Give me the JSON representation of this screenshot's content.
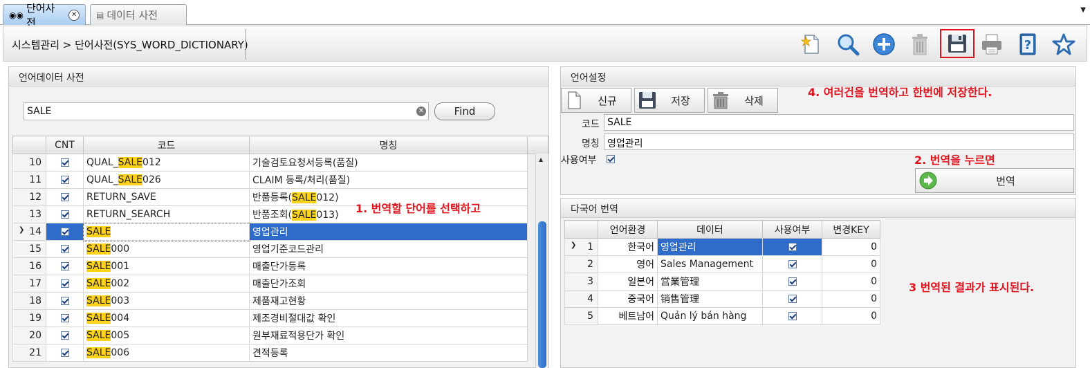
{
  "tabs": [
    {
      "label": "단어사전",
      "icon": "binoculars-icon",
      "active": true
    },
    {
      "label": "데이터 사전",
      "icon": "building-icon",
      "active": false
    }
  ],
  "breadcrumb": "시스템관리 > 단어사전(SYS_WORD_DICTIONARY)",
  "toolbar_icons": [
    "new-document-icon",
    "search-icon",
    "add-icon",
    "delete-icon",
    "save-icon",
    "print-icon",
    "help-icon",
    "favorite-icon"
  ],
  "left_panel": {
    "title": "언어데이터 사전",
    "search_value": "SALE",
    "find_label": "Find",
    "columns": [
      "CNT",
      "코드",
      "명칭"
    ],
    "rows": [
      {
        "no": "10",
        "code_pre": "QUAL_",
        "code_hl": "SALE",
        "code_post": "012",
        "name_pre": "기술검토요청서등록(품질)",
        "name_hl": "",
        "name_post": ""
      },
      {
        "no": "11",
        "code_pre": "QUAL_",
        "code_hl": "SALE",
        "code_post": "026",
        "name_pre": "CLAIM 등록/처리(품질)",
        "name_hl": "",
        "name_post": ""
      },
      {
        "no": "12",
        "code_pre": "RETURN_SAVE",
        "code_hl": "",
        "code_post": "",
        "name_pre": "반품등록(",
        "name_hl": "SALE",
        "name_post": "012)"
      },
      {
        "no": "13",
        "code_pre": "RETURN_SEARCH",
        "code_hl": "",
        "code_post": "",
        "name_pre": "반품조회(",
        "name_hl": "SALE",
        "name_post": "013)"
      },
      {
        "no": "14",
        "code_pre": "",
        "code_hl": "SALE",
        "code_post": "",
        "name_pre": "영업관리",
        "name_hl": "",
        "name_post": "",
        "selected": true
      },
      {
        "no": "15",
        "code_pre": "",
        "code_hl": "SALE",
        "code_post": "000",
        "name_pre": "영업기준코드관리",
        "name_hl": "",
        "name_post": ""
      },
      {
        "no": "16",
        "code_pre": "",
        "code_hl": "SALE",
        "code_post": "001",
        "name_pre": "매출단가등록",
        "name_hl": "",
        "name_post": ""
      },
      {
        "no": "17",
        "code_pre": "",
        "code_hl": "SALE",
        "code_post": "002",
        "name_pre": "매출단가조회",
        "name_hl": "",
        "name_post": ""
      },
      {
        "no": "18",
        "code_pre": "",
        "code_hl": "SALE",
        "code_post": "003",
        "name_pre": "제품재고현황",
        "name_hl": "",
        "name_post": ""
      },
      {
        "no": "19",
        "code_pre": "",
        "code_hl": "SALE",
        "code_post": "004",
        "name_pre": "제조경비절대값 확인",
        "name_hl": "",
        "name_post": ""
      },
      {
        "no": "20",
        "code_pre": "",
        "code_hl": "SALE",
        "code_post": "005",
        "name_pre": "원부재료적용단가 확인",
        "name_hl": "",
        "name_post": ""
      },
      {
        "no": "21",
        "code_pre": "",
        "code_hl": "SALE",
        "code_post": "006",
        "name_pre": "견적등록",
        "name_hl": "",
        "name_post": ""
      }
    ]
  },
  "annotations": {
    "step1": "1. 번역할 단어를 선택하고",
    "step2": "2. 번역을 누르면",
    "step3": "3 번역된 결과가 표시된다.",
    "step4": "4. 여러건을 번역하고 한번에 저장한다."
  },
  "settings_panel": {
    "title": "언어설정",
    "new_label": "신규",
    "save_label": "저장",
    "delete_label": "삭제",
    "code_label": "코드",
    "code_value": "SALE",
    "name_label": "명칭",
    "name_value": "영업관리",
    "use_label": "사용여부",
    "translate_label": "번역"
  },
  "translation_panel": {
    "title": "다국어 번역",
    "columns": [
      "언어환경",
      "데이터",
      "사용여부",
      "변경KEY"
    ],
    "rows": [
      {
        "no": "1",
        "lang": "한국어",
        "data": "영업관리",
        "key": "0",
        "selected": true
      },
      {
        "no": "2",
        "lang": "영어",
        "data": "Sales Management",
        "key": "0"
      },
      {
        "no": "3",
        "lang": "일본어",
        "data": "営業管理",
        "key": "0"
      },
      {
        "no": "4",
        "lang": "중국어",
        "data": "销售管理",
        "key": "0"
      },
      {
        "no": "5",
        "lang": "베트남어",
        "data": "Quản lý bán hàng",
        "key": "0"
      }
    ]
  },
  "colors": {
    "selection": "#2f6cc9",
    "highlight": "#ffd21a",
    "annotation": "#e0141e"
  }
}
